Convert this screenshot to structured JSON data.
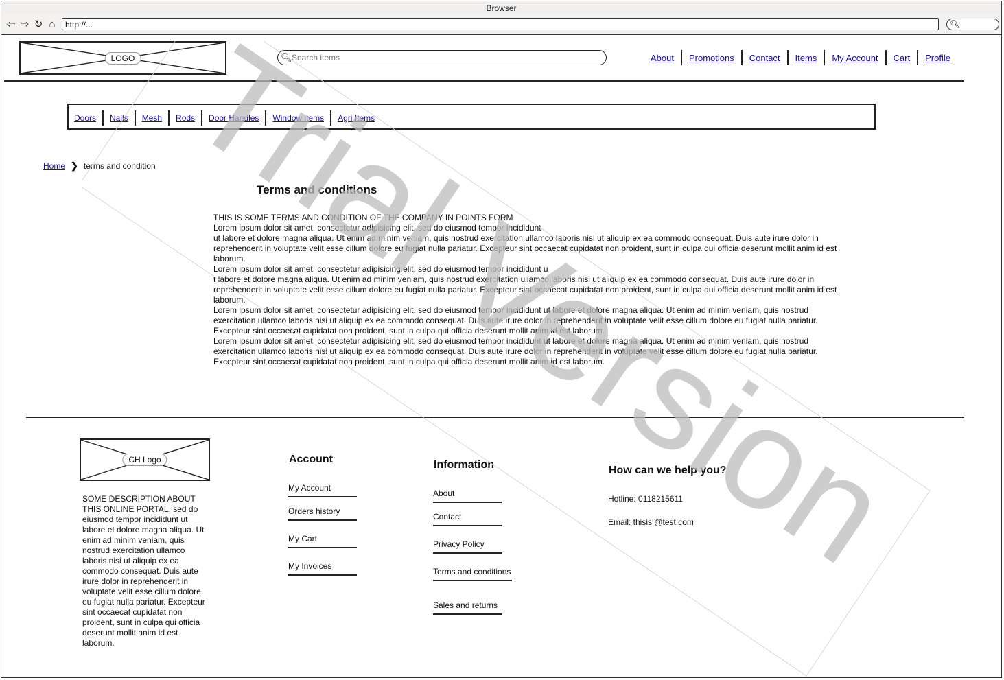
{
  "browser": {
    "title": "Browser",
    "url": "http://..."
  },
  "header": {
    "logo_label": "LOGO",
    "search_placeholder": "Search items",
    "nav": [
      "About",
      "Promotions",
      "Contact",
      "Items",
      "My Account",
      "Cart",
      "Profile"
    ]
  },
  "categories": [
    "Doors",
    "Nails",
    "Mesh",
    "Rods",
    "Door Handles",
    "Window items",
    "Agri Items"
  ],
  "breadcrumb": {
    "home": "Home",
    "current": "terms and condition"
  },
  "main": {
    "title": "Terms and conditions",
    "lines": [
      "THIS IS SOME TERMS AND CONDITION OF THE COMPANY IN POINTS FORM",
      "Lorem ipsum dolor sit amet, consectetur adipisicing elit, sed do eiusmod tempor incididunt",
      "ut labore et dolore magna aliqua. Ut enim ad minim veniam, quis nostrud exercitation ullamco laboris nisi ut aliquip ex ea commodo consequat. Duis aute irure dolor in reprehenderit in voluptate velit esse cillum dolore eu fugiat nulla pariatur. Excepteur sint occaecat cupidatat non proident, sunt in culpa qui officia deserunt mollit anim id est laborum.",
      "Lorem ipsum dolor sit amet, consectetur adipisicing elit, sed do eiusmod tempor incididunt u",
      "t labore et dolore magna aliqua. Ut enim ad minim veniam, quis nostrud exercitation ullamco laboris nisi ut aliquip ex ea commodo consequat. Duis aute irure dolor in reprehenderit in voluptate velit esse cillum dolore eu fugiat nulla pariatur. Excepteur sint occaecat cupidatat non proident, sunt in culpa qui officia deserunt mollit anim id est laborum.",
      "Lorem ipsum dolor sit amet, consectetur adipisicing elit, sed do eiusmod tempor incididunt ut labore et dolore magna aliqua. Ut enim ad minim veniam, quis nostrud exercitation ullamco laboris nisi ut aliquip ex ea commodo consequat. Duis aute irure dolor in reprehenderit in voluptate velit esse cillum dolore eu fugiat nulla pariatur. Excepteur sint occaecat cupidatat non proident, sunt in culpa qui officia deserunt mollit anim id est laborum.",
      "Lorem ipsum dolor sit amet, consectetur adipisicing elit, sed do eiusmod tempor incididunt ut labore et dolore magna aliqua. Ut enim ad minim veniam, quis nostrud exercitation ullamco laboris nisi ut aliquip ex ea commodo consequat. Duis aute irure dolor in reprehenderit in voluptate velit esse cillum dolore eu fugiat nulla pariatur. Excepteur sint occaecat cupidatat non proident, sunt in culpa qui officia deserunt mollit anim id est laborum."
    ]
  },
  "footer": {
    "logo_label": "CH Logo",
    "description": "SOME DESCRIPTION ABOUT THIS ONLINE PORTAL, sed do eiusmod tempor incididunt ut labore et dolore magna aliqua. Ut enim ad minim veniam, quis nostrud exercitation ullamco laboris nisi ut aliquip ex ea commodo consequat. Duis aute irure dolor in reprehenderit in voluptate velit esse cillum dolore eu fugiat nulla pariatur. Excepteur sint occaecat cupidatat non proident, sunt in culpa qui officia deserunt mollit anim id est laborum.",
    "account": {
      "title": "Account",
      "links": [
        "My Account",
        "Orders history",
        "My Cart",
        "My Invoices"
      ]
    },
    "information": {
      "title": "Information",
      "links": [
        "About",
        "Contact",
        "Privacy Policy",
        "Terms and conditions",
        "Sales and returns"
      ]
    },
    "help": {
      "title": "How can we help you?",
      "hotline": "Hotline: 0118215611",
      "email": "Email: thisis @test.com"
    }
  },
  "watermark": "Trial Version",
  "icons": [
    "back-arrow-icon",
    "forward-arrow-icon",
    "reload-icon",
    "home-icon",
    "search-icon",
    "chevron-right-icon"
  ]
}
